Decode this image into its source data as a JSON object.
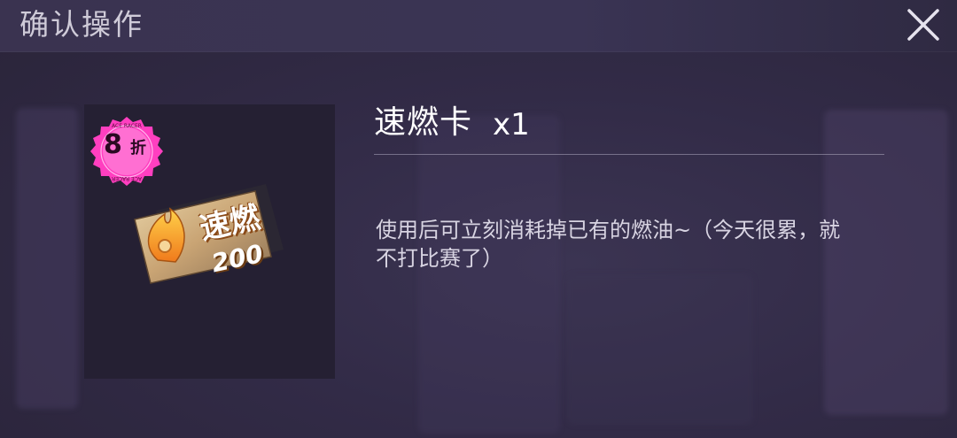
{
  "dialog": {
    "title": "确认操作",
    "close_icon": "close-icon"
  },
  "item": {
    "name": "速燃卡",
    "quantity": "x1",
    "description": "使用后可立刻消耗掉已有的燃油~（今天很累，就不打比赛了）",
    "card_text_top": "速燃",
    "card_text_bottom": "200"
  },
  "badge": {
    "number": "8",
    "unit": "折",
    "ring_text": "ACE RACER",
    "color": "#ff3fc0"
  },
  "colors": {
    "background": "#322b47",
    "text_primary": "#ffffff",
    "text_secondary": "#d8d4e2"
  }
}
